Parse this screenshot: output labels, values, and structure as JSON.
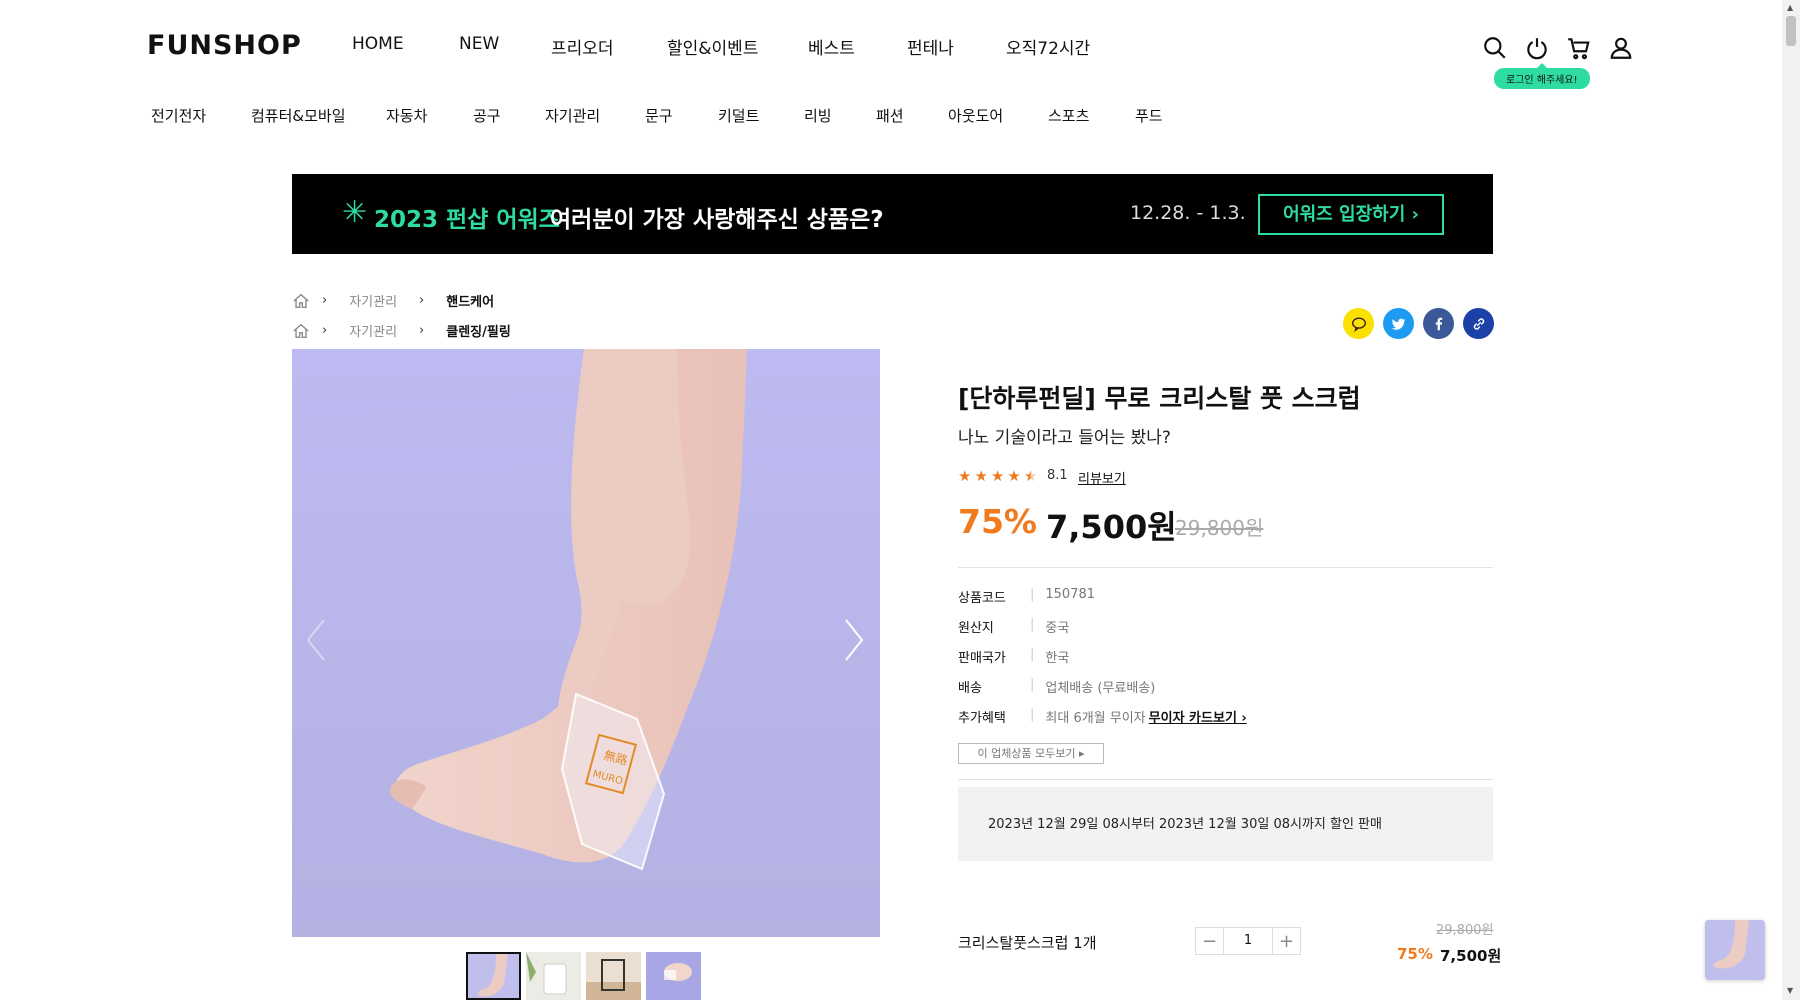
{
  "header": {
    "logo": "FUNSHOP",
    "nav": [
      "HOME",
      "NEW",
      "프리오더",
      "할인&이벤트",
      "베스트",
      "펀테나",
      "오직72시간"
    ],
    "login_tip": "로그인 해주세요!",
    "icons": [
      "search-icon",
      "power-icon",
      "cart-icon",
      "user-icon"
    ]
  },
  "categories": [
    "전기전자",
    "컴퓨터&모바일",
    "자동차",
    "공구",
    "자기관리",
    "문구",
    "키덜트",
    "리빙",
    "패션",
    "아웃도어",
    "스포츠",
    "푸드"
  ],
  "banner": {
    "star": "✳",
    "highlight": "2023 펀샵 어워즈",
    "text": "여러분이 가장 사랑해주신 상품은?",
    "date": "12.28. - 1.3.",
    "button": "어워즈 입장하기 ›"
  },
  "breadcrumbs": [
    {
      "level1": "자기관리",
      "level2": "핸드케어"
    },
    {
      "level1": "자기관리",
      "level2": "클렌징/필링"
    }
  ],
  "share_icons": [
    "kakao-icon",
    "twitter-icon",
    "facebook-icon",
    "link-icon"
  ],
  "colors": {
    "accent": "#f07b1f",
    "brand_green": "#2fdca0",
    "kakao": "#fae100",
    "twitter": "#1d9bf0",
    "facebook": "#3b5998",
    "link": "#1c3fa8"
  },
  "product": {
    "title": "[단하루펀딜] 무로 크리스탈 풋 스크럽",
    "subtitle": "나노 기술이라고 들어는 봤나?",
    "rating": "8.1",
    "rating_stars": 4.5,
    "review_link": "리뷰보기",
    "discount": "75%",
    "price": "7,500원",
    "original_price": "29,800원",
    "info": [
      {
        "key": "상품코드",
        "value": "150781"
      },
      {
        "key": "원산지",
        "value": "중국"
      },
      {
        "key": "판매국가",
        "value": "한국"
      },
      {
        "key": "배송",
        "value": "업체배송 (무료배송)"
      },
      {
        "key": "추가혜택",
        "value": "최대 6개월 무이자",
        "link": "무이자 카드보기 ›"
      }
    ],
    "seller_button": "이 업체상품 모두보기 ▸",
    "notice": "2023년 12월 29일 08시부터 2023년 12월 30일 08시까지 할인 판매",
    "option": {
      "name": "크리스탈풋스크럽 1개",
      "quantity": "1",
      "minus": "−",
      "plus": "+",
      "original_price": "29,800원",
      "discount": "75%",
      "price": "7,500원"
    },
    "image_label": "無路 MURO"
  }
}
